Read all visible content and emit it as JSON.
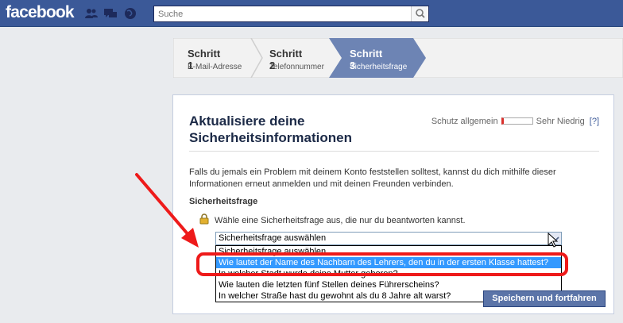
{
  "header": {
    "logo": "facebook",
    "search_placeholder": "Suche"
  },
  "steps": [
    {
      "title": "Schritt 1",
      "sub": "E-Mail-Adresse"
    },
    {
      "title": "Schritt 2",
      "sub": "Telefonnummer"
    },
    {
      "title": "Schritt 3",
      "sub": "Sicherheitsfrage"
    }
  ],
  "card": {
    "title": "Aktualisiere deine Sicherheitsinformationen",
    "protection_label": "Schutz allgemein",
    "protection_value": "Sehr Niedrig",
    "help": "[?]",
    "description": "Falls du jemals ein Problem mit deinem Konto feststellen solltest, kannst du dich mithilfe dieser Informationen erneut anmelden und mit deinen Freunden verbinden.",
    "section_label": "Sicherheitsfrage",
    "hint": "Wähle eine Sicherheitsfrage aus, die nur du beantworten kannst.",
    "select_value": "Sicherheitsfrage auswählen",
    "options": [
      "Sicherheitsfrage auswählen",
      "Wie lautet der Name des Nachbarn des Lehrers, den du in der ersten Klasse hattest?",
      "In welcher Stadt wurde deine Mutter geboren?",
      "Wie lauten die letzten fünf Stellen deines Führerscheins?",
      "In welcher Straße hast du gewohnt als du 8 Jahre alt warst?"
    ],
    "save_label": "Speichern und fortfahren"
  },
  "colors": {
    "brand": "#3b5998",
    "highlight": "#ee1a1a",
    "option_selected": "#3399ff"
  }
}
